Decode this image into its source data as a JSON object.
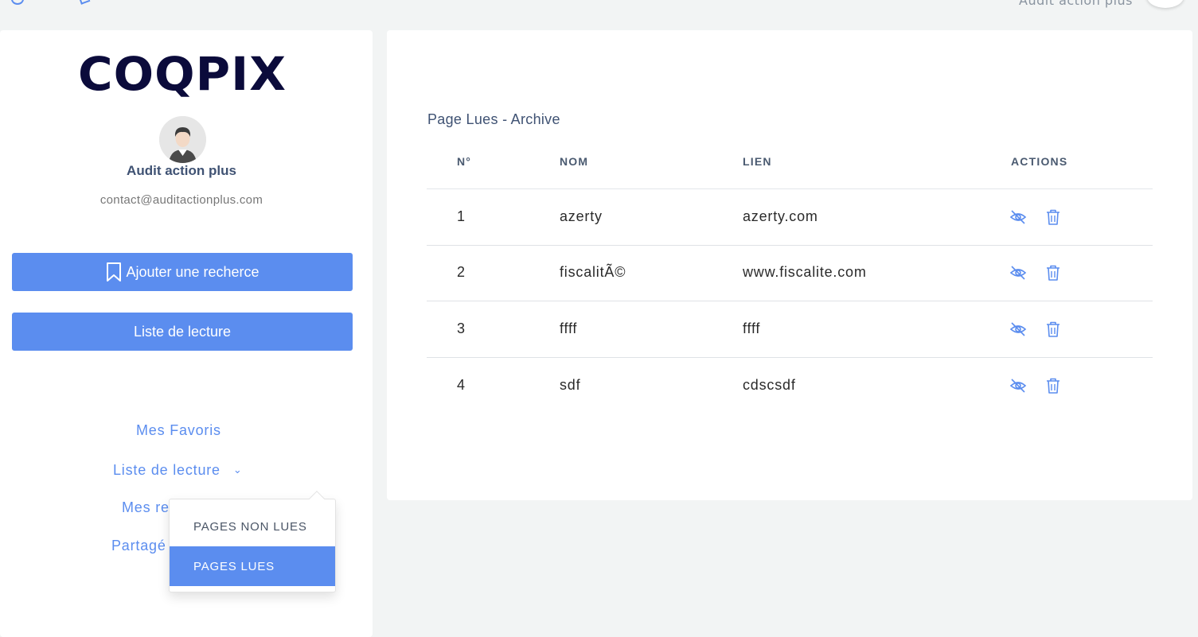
{
  "topbar": {
    "user_name": "Audit action plus"
  },
  "sidebar": {
    "logo_text": "COQPIX",
    "user_name": "Audit action plus",
    "user_email": "contact@auditactionplus.com",
    "add_button_label": "Ajouter une recherce",
    "list_button_label": "Liste de lecture",
    "nav": {
      "favoris": "Mes Favoris",
      "lecture": "Liste de lecture",
      "mes_partial": "Mes re",
      "partage_partial": "Partagé"
    },
    "dropdown": {
      "items": [
        "PAGES NON LUES",
        "PAGES LUES"
      ],
      "selected": "PAGES LUES"
    }
  },
  "main": {
    "title": "Page Lues - Archive",
    "columns": [
      "N°",
      "NOM",
      "LIEN",
      "ACTIONS"
    ],
    "rows": [
      {
        "n": "1",
        "nom": "azerty",
        "lien": "azerty.com"
      },
      {
        "n": "2",
        "nom": "fiscalitÃ©",
        "lien": "www.fiscalite.com"
      },
      {
        "n": "3",
        "nom": "ffff",
        "lien": "ffff"
      },
      {
        "n": "4",
        "nom": "sdf",
        "lien": "cdscsdf"
      }
    ],
    "icons": {
      "view": "eye-off-icon",
      "delete": "trash-icon"
    }
  },
  "colors": {
    "accent": "#5b8def",
    "navy": "#0b0b3b",
    "heading": "#3f5273"
  }
}
